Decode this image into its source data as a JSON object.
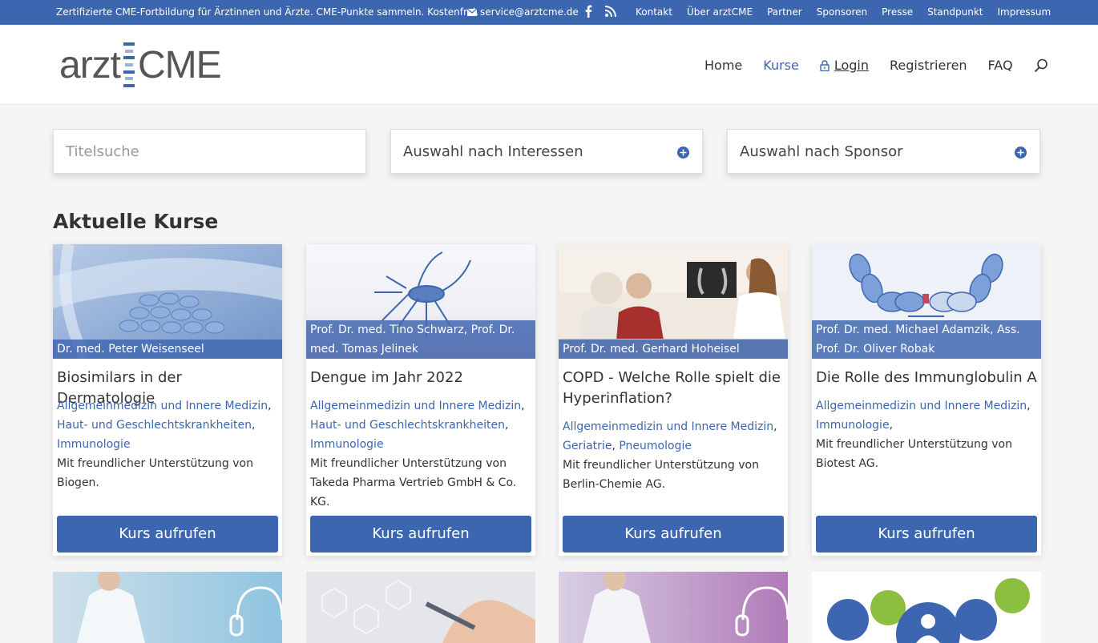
{
  "topbar": {
    "claim": "Zertifizierte CME-Fortbildung für Ärztinnen und Ärzte. CME-Punkte sammeln. Kostenfrei.",
    "email": "service@arztcme.de",
    "links": [
      "Kontakt",
      "Über arztCME",
      "Partner",
      "Sponsoren",
      "Presse",
      "Standpunkt",
      "Impressum"
    ]
  },
  "logo": {
    "part1": "arzt",
    "part2": "CME"
  },
  "nav": {
    "home": "Home",
    "courses": "Kurse",
    "login": "Login",
    "register": "Registrieren",
    "faq": "FAQ"
  },
  "filters": {
    "title_placeholder": "Titelsuche",
    "interests": "Auswahl nach Interessen",
    "sponsor": "Auswahl nach Sponsor"
  },
  "section_title": "Aktuelle Kurse",
  "button_label": "Kurs aufrufen",
  "courses": [
    {
      "author": "Dr. med. Peter Weisenseel",
      "title": "Biosimilars in der Dermatologie",
      "categories": [
        "Allgemeinmedizin und Innere Medizin",
        "Haut- und Geschlechtskrankheiten",
        "Immunologie"
      ],
      "support": "Mit freundlicher Unterstützung von Biogen."
    },
    {
      "author": "Prof. Dr. med. Tino Schwarz, Prof. Dr. med. Tomas Jelinek",
      "title": "Dengue im Jahr 2022",
      "categories": [
        "Allgemeinmedizin und Innere Medizin",
        "Haut- und Geschlechtskrankheiten",
        "Immunologie"
      ],
      "support": "Mit freundlicher Unterstützung von Takeda Pharma Vertrieb GmbH & Co. KG."
    },
    {
      "author": "Prof. Dr. med. Gerhard Hoheisel",
      "title": "COPD - Welche Rolle spielt die Hyperinflation?",
      "categories": [
        "Allgemeinmedizin und Innere Medizin",
        "Geriatrie",
        "Pneumologie"
      ],
      "support": "Mit freundlicher Unterstützung von Berlin-Chemie AG."
    },
    {
      "author": "Prof. Dr. med. Michael Adamzik, Ass. Prof. Dr. Oliver Robak",
      "title": "Die Rolle des Immunglobulin A",
      "categories": [
        "Allgemeinmedizin und Innere Medizin",
        "Immunologie"
      ],
      "support": "Mit freundlicher Unterstützung von Biotest AG."
    }
  ],
  "colors": {
    "brand": "#3d66b0",
    "link": "#3d66b0",
    "background": "#f5f5f5"
  }
}
